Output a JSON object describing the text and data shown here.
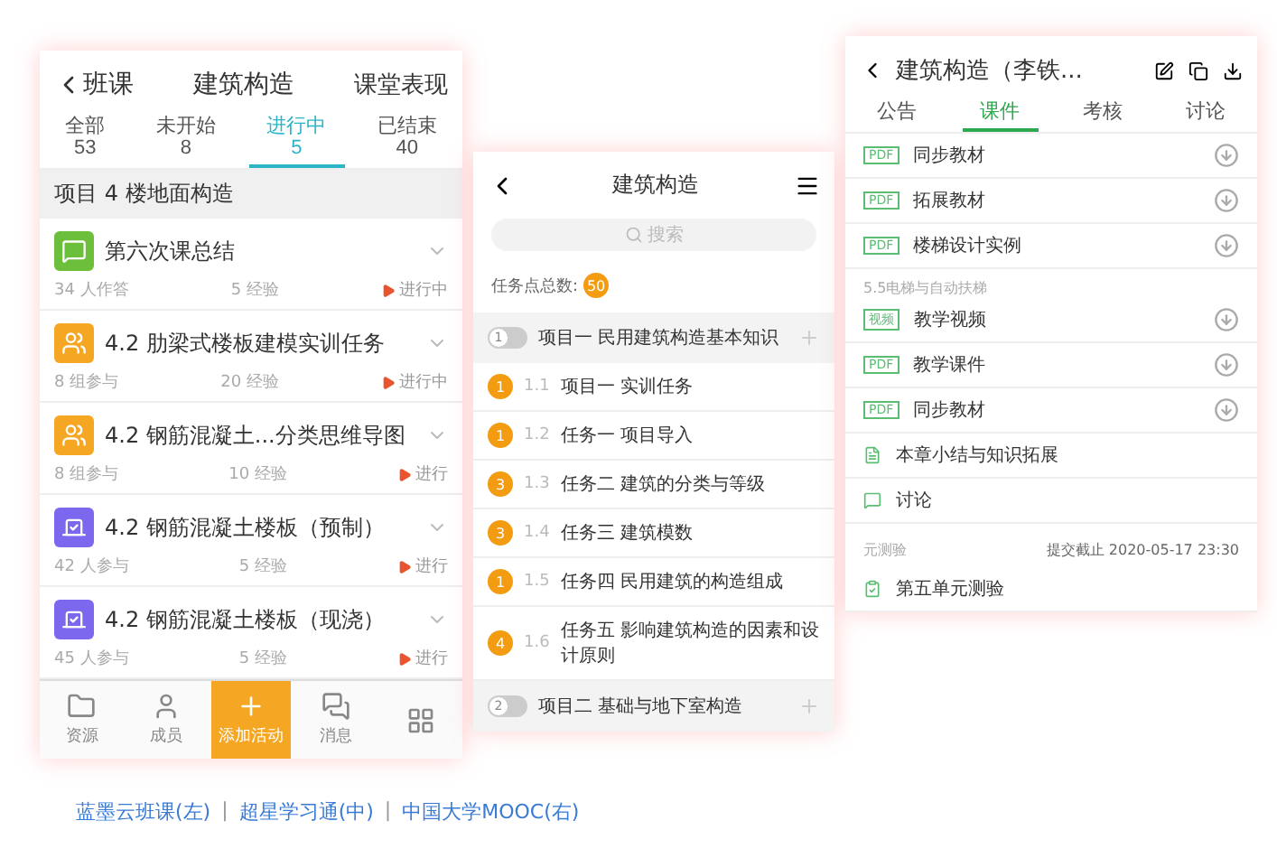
{
  "left_app": {
    "back": "班课",
    "title": "建筑构造",
    "action": "课堂表现",
    "tabs": [
      {
        "label": "全部",
        "count": "53",
        "selected": false
      },
      {
        "label": "未开始",
        "count": "8",
        "selected": false
      },
      {
        "label": "进行中",
        "count": "5",
        "selected": true
      },
      {
        "label": "已结束",
        "count": "40",
        "selected": false
      }
    ],
    "section": "项目 4 楼地面构造",
    "items": [
      {
        "kind": "discussion",
        "title": "第六次课总结",
        "participants": "34 人作答",
        "exp": "5 经验",
        "status": "进行中"
      },
      {
        "kind": "task",
        "title": "4.2 肋梁式楼板建模实训任务",
        "participants": "8 组参与",
        "exp": "20 经验",
        "status": "进行中"
      },
      {
        "kind": "task",
        "title": "4.2 钢筋混凝土...分类思维导图",
        "participants": "8 组参与",
        "exp": "10 经验",
        "status": "进行"
      },
      {
        "kind": "vote",
        "title": "4.2 钢筋混凝土楼板（预制）",
        "participants": "42 人参与",
        "exp": "5 经验",
        "status": "进行"
      },
      {
        "kind": "vote",
        "title": "4.2 钢筋混凝土楼板（现浇）",
        "participants": "45 人参与",
        "exp": "5 经验",
        "status": "进行"
      }
    ],
    "nav": [
      {
        "kind": "folder",
        "label": "资源"
      },
      {
        "kind": "person",
        "label": "成员"
      },
      {
        "kind": "add",
        "label": "添加活动"
      },
      {
        "kind": "chat",
        "label": "消息"
      },
      {
        "kind": "grid"
      }
    ]
  },
  "middle_app": {
    "title": "建筑构造",
    "search_placeholder": "搜索",
    "total_label": "任务点总数:",
    "total": "50",
    "rows": [
      {
        "kind": "project",
        "number": "1",
        "title": "项目一 民用建筑构造基本知识"
      },
      {
        "kind": "task",
        "count": "1",
        "number": "1.1",
        "title": "项目一 实训任务"
      },
      {
        "kind": "task",
        "count": "1",
        "number": "1.2",
        "title": "任务一 项目导入"
      },
      {
        "kind": "task",
        "count": "3",
        "number": "1.3",
        "title": "任务二 建筑的分类与等级"
      },
      {
        "kind": "task",
        "count": "3",
        "number": "1.4",
        "title": "任务三 建筑模数"
      },
      {
        "kind": "task",
        "count": "1",
        "number": "1.5",
        "title": "任务四 民用建筑的构造组成"
      },
      {
        "kind": "task",
        "count": "4",
        "number": "1.6",
        "title": "任务五 影响建筑构造的因素和设计原则"
      },
      {
        "kind": "project",
        "number": "2",
        "title": "项目二 基础与地下室构造"
      }
    ]
  },
  "right_app": {
    "title": "建筑构造（李铁...",
    "tabs": [
      {
        "label": "公告",
        "selected": false
      },
      {
        "label": "课件",
        "selected": true
      },
      {
        "label": "考核",
        "selected": false
      },
      {
        "label": "讨论",
        "selected": false
      }
    ],
    "rows": [
      {
        "kind": "file",
        "badge": "PDF",
        "title": "同步教材",
        "download": true
      },
      {
        "kind": "file",
        "badge": "PDF",
        "title": "拓展教材",
        "download": true
      },
      {
        "kind": "file",
        "badge": "PDF",
        "title": "楼梯设计实例",
        "download": true
      },
      {
        "kind": "section",
        "title": "5.5电梯与自动扶梯"
      },
      {
        "kind": "file",
        "badge": "视频",
        "title": "教学视频",
        "download": true
      },
      {
        "kind": "file",
        "badge": "PDF",
        "title": "教学课件",
        "download": true
      },
      {
        "kind": "file",
        "badge": "PDF",
        "title": "同步教材",
        "download": true
      },
      {
        "kind": "doc",
        "title": "本章小结与知识拓展",
        "download": false
      },
      {
        "kind": "discussion",
        "title": "讨论",
        "download": false
      },
      {
        "kind": "quiz_section",
        "title": "元测验",
        "deadline": "提交截止 2020-05-17 23:30"
      },
      {
        "kind": "quiz",
        "title": "第五单元测验",
        "download": false
      }
    ]
  },
  "caption": [
    {
      "label": "蓝墨云班课(左)"
    },
    {
      "separator": "|",
      "label": "超星学习通(中)"
    },
    {
      "separator": "|",
      "label": "中国大学MOOC(右)"
    }
  ]
}
